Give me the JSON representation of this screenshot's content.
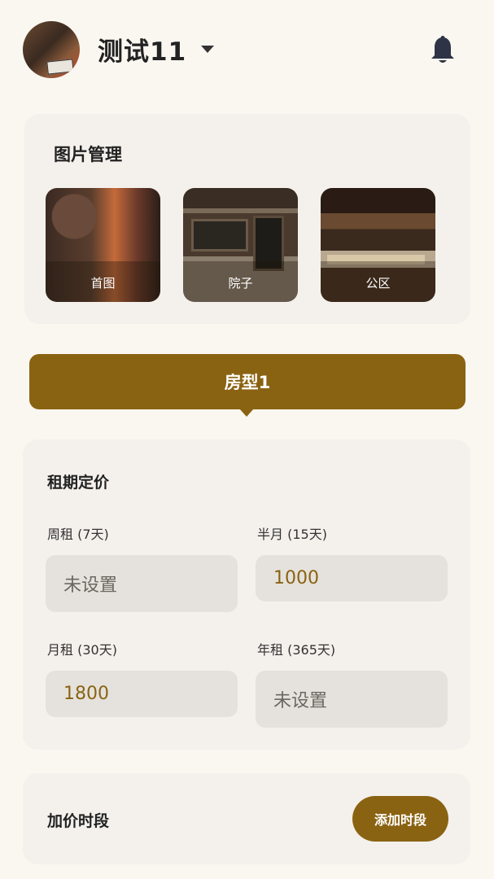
{
  "header": {
    "title": "测试11",
    "dropdown_icon": "chevron-down-icon",
    "notification_icon": "bell-icon"
  },
  "images": {
    "title": "图片管理",
    "items": [
      {
        "label": "首图"
      },
      {
        "label": "院子"
      },
      {
        "label": "公区"
      }
    ]
  },
  "room": {
    "label": "房型1"
  },
  "pricing": {
    "title": "租期定价",
    "fields": [
      {
        "label": "周租 (7天)",
        "value": "未设置"
      },
      {
        "label": "半月 (15天)",
        "value": "1000"
      },
      {
        "label": "月租 (30天)",
        "value": "1800"
      },
      {
        "label": "年租 (365天)",
        "value": "未设置"
      }
    ]
  },
  "surcharge": {
    "title": "加价时段",
    "add_label": "添加时段"
  },
  "colors": {
    "accent": "#8a6312",
    "background": "#faf7f1",
    "card": "#f4f1ec"
  }
}
